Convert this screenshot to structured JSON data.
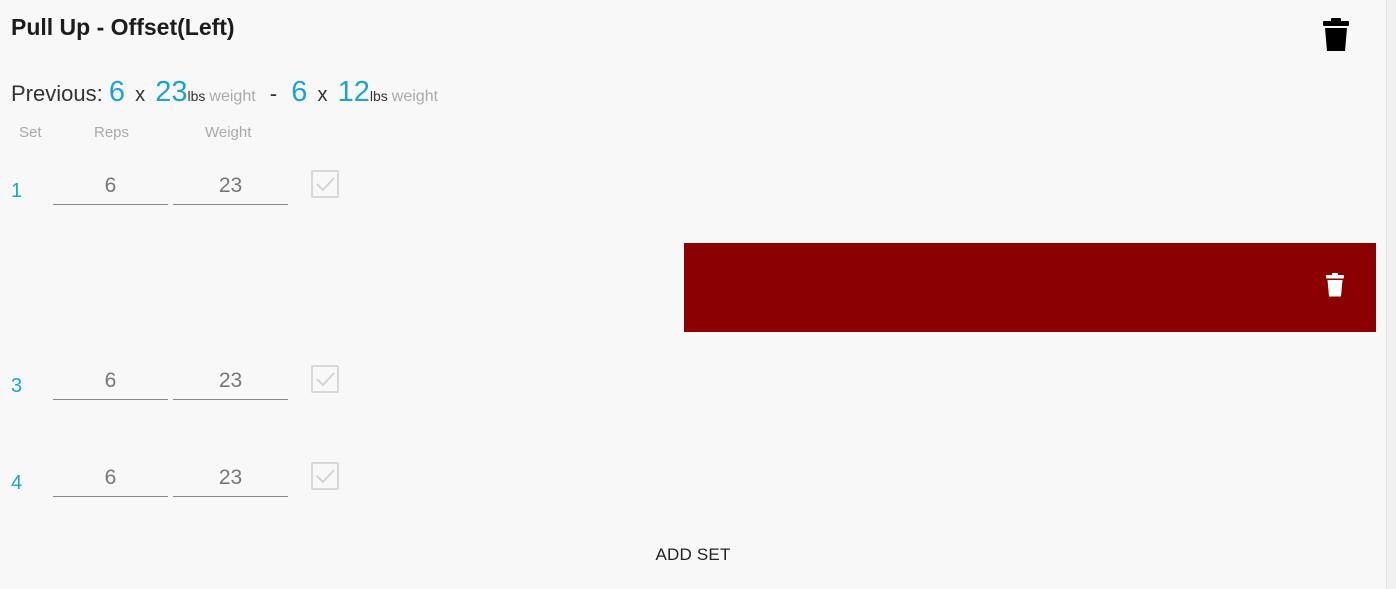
{
  "exercise": {
    "title": "Pull Up - Offset(Left)"
  },
  "previous": {
    "label": "Previous:",
    "first": {
      "reps": "6",
      "x": "x",
      "weight": "23",
      "unit": "lbs",
      "word": "weight"
    },
    "separator": "-",
    "second": {
      "reps": "6",
      "x": "x",
      "weight": "12",
      "unit": "lbs",
      "word": "weight"
    }
  },
  "columns": {
    "set": "Set",
    "reps": "Reps",
    "weight": "Weight"
  },
  "sets": [
    {
      "number": "1",
      "reps": "6",
      "weight": "23"
    },
    {
      "number": "3",
      "reps": "6",
      "weight": "23"
    },
    {
      "number": "4",
      "reps": "6",
      "weight": "23"
    }
  ],
  "add_set_label": "ADD SET",
  "icons": {
    "delete_exercise": "trash-icon",
    "delete_set": "trash-icon",
    "complete": "checkbox-icon"
  },
  "colors": {
    "accent": "#1ea3cf",
    "delete_background": "#8b0000"
  }
}
